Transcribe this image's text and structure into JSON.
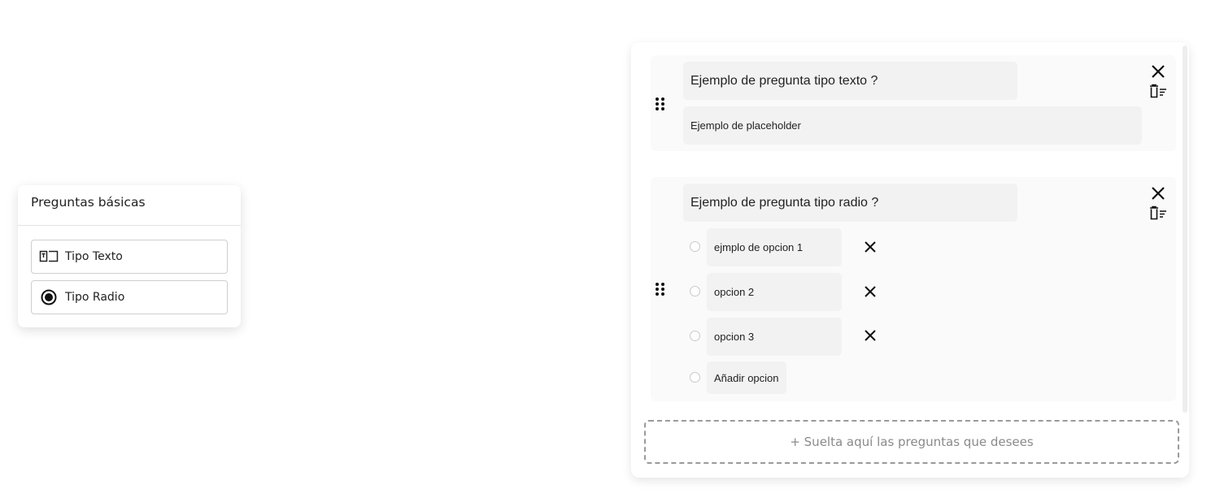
{
  "palette": {
    "title": "Preguntas básicas",
    "items": [
      {
        "label": "Tipo Texto",
        "icon": "text-field-icon"
      },
      {
        "label": "Tipo Radio",
        "icon": "radio-button-icon"
      }
    ]
  },
  "questions": [
    {
      "type": "text",
      "title": "Ejemplo de pregunta tipo texto ?",
      "placeholder_value": "Ejemplo de placeholder"
    },
    {
      "type": "radio",
      "title": "Ejemplo de pregunta tipo radio ?",
      "options": [
        "ejmplo de opcion 1",
        "opcion 2",
        "opcion 3"
      ],
      "add_option_label": "Añadir opcion"
    }
  ],
  "dropzone": {
    "label": "+ Suelta aquí las preguntas que desees"
  },
  "colors": {
    "card_bg": "#fafafa",
    "input_bg": "#f2f2f2",
    "dropzone_border": "#9a9a9a",
    "dropzone_text": "#8a8a8a"
  }
}
